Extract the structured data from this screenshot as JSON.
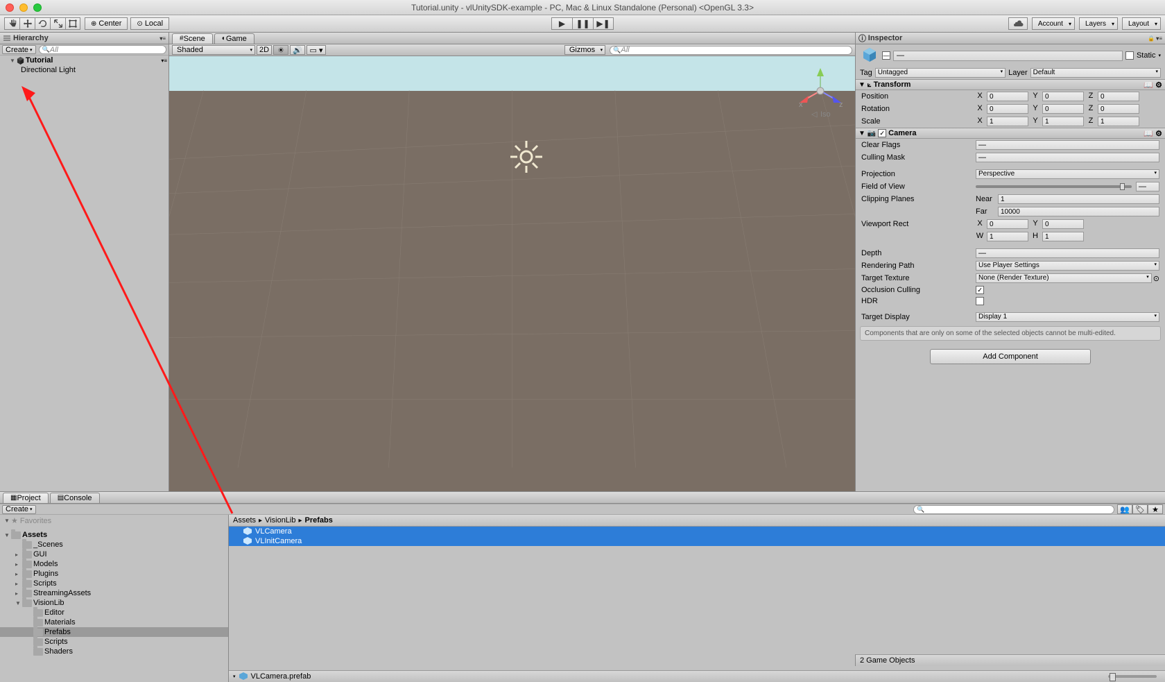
{
  "window": {
    "title": "Tutorial.unity - vlUnitySDK-example - PC, Mac & Linux Standalone (Personal) <OpenGL 3.3>"
  },
  "toolbar": {
    "pivot1": "Center",
    "pivot2": "Local",
    "cloud": "☁",
    "account": "Account",
    "layers": "Layers",
    "layout": "Layout"
  },
  "hierarchy": {
    "title": "Hierarchy",
    "create": "Create",
    "search_placeholder": "All",
    "scene": "Tutorial",
    "items": [
      "Directional Light"
    ]
  },
  "sceneTabs": {
    "scene": "Scene",
    "game": "Game"
  },
  "sceneToolbar": {
    "shading": "Shaded",
    "mode2d": "2D",
    "gizmos": "Gizmos",
    "search_placeholder": "All",
    "iso": "Iso"
  },
  "inspector": {
    "title": "Inspector",
    "static": "Static",
    "tag_label": "Tag",
    "tag_value": "Untagged",
    "layer_label": "Layer",
    "layer_value": "Default",
    "transform": {
      "title": "Transform",
      "position": "Position",
      "rotation": "Rotation",
      "scale": "Scale",
      "px": "0",
      "py": "0",
      "pz": "0",
      "rx": "0",
      "ry": "0",
      "rz": "0",
      "sx": "1",
      "sy": "1",
      "sz": "1"
    },
    "camera": {
      "title": "Camera",
      "clearFlags": "Clear Flags",
      "cullingMask": "Culling Mask",
      "projection": "Projection",
      "projection_value": "Perspective",
      "fov": "Field of View",
      "clipping": "Clipping Planes",
      "near": "Near",
      "near_v": "1",
      "far": "Far",
      "far_v": "10000",
      "viewport": "Viewport Rect",
      "vx": "0",
      "vy": "0",
      "vw": "1",
      "vh": "1",
      "depth": "Depth",
      "renderPath": "Rendering Path",
      "renderPath_v": "Use Player Settings",
      "targetTex": "Target Texture",
      "targetTex_v": "None (Render Texture)",
      "occlusion": "Occlusion Culling",
      "hdr": "HDR",
      "targetDisplay": "Target Display",
      "targetDisplay_v": "Display 1"
    },
    "multiedit_note": "Components that are only on some of the selected objects cannot be multi-edited.",
    "addComponent": "Add Component"
  },
  "project": {
    "title": "Project",
    "console": "Console",
    "create": "Create",
    "assets": "Assets",
    "folders": [
      "_Scenes",
      "GUI",
      "Models",
      "Plugins",
      "Scripts",
      "StreamingAssets"
    ],
    "visionlib": "VisionLib",
    "vlsub": [
      "Editor",
      "Materials",
      "Prefabs",
      "Scripts",
      "Shaders"
    ],
    "breadcrumb": [
      "Assets",
      "VisionLib",
      "Prefabs"
    ],
    "files": [
      "VLCamera",
      "VLInitCamera"
    ],
    "footer_file": "VLCamera.prefab",
    "footer_count": "2 Game Objects"
  }
}
